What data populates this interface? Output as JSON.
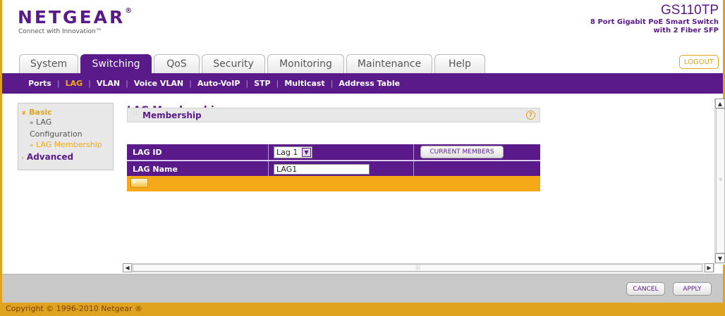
{
  "header": {
    "logo": "NETGEAR",
    "logo_mark": "®",
    "tagline": "Connect with Innovation™",
    "model": "GS110TP",
    "model_desc_line1": "8 Port Gigabit PoE Smart Switch",
    "model_desc_line2": "with 2 Fiber SFP",
    "logout_label": "LOGOUT"
  },
  "tabs": [
    {
      "label": "System",
      "active": false
    },
    {
      "label": "Switching",
      "active": true
    },
    {
      "label": "QoS",
      "active": false
    },
    {
      "label": "Security",
      "active": false
    },
    {
      "label": "Monitoring",
      "active": false
    },
    {
      "label": "Maintenance",
      "active": false
    },
    {
      "label": "Help",
      "active": false
    }
  ],
  "subnav": [
    {
      "label": "Ports",
      "active": false
    },
    {
      "label": "LAG",
      "active": true
    },
    {
      "label": "VLAN",
      "active": false
    },
    {
      "label": "Voice VLAN",
      "active": false
    },
    {
      "label": "Auto-VoIP",
      "active": false
    },
    {
      "label": "STP",
      "active": false
    },
    {
      "label": "Multicast",
      "active": false
    },
    {
      "label": "Address Table",
      "active": false
    }
  ],
  "sidebar": {
    "basic": "Basic",
    "items": [
      {
        "label": "LAG Configuration",
        "line1": "LAG",
        "line2": "Configuration",
        "active": false
      },
      {
        "label": "LAG Membership",
        "active": true
      }
    ],
    "advanced": "Advanced"
  },
  "main": {
    "title": "LAG Membership",
    "panel_title": "Membership",
    "help_icon": "?",
    "lag_id_label": "LAG ID",
    "lag_id_value": "Lag 1",
    "current_members_label": "CURRENT MEMBERS",
    "lag_name_label": "LAG Name",
    "lag_name_value": "LAG1"
  },
  "actions": {
    "cancel": "CANCEL",
    "apply": "APPLY"
  },
  "footer": {
    "copyright": "Copyright © 1996-2010 Netgear ®"
  },
  "colors": {
    "brand_purple": "#5a1a8a",
    "accent_orange": "#f5a818",
    "frame_gold": "#e0a320"
  }
}
